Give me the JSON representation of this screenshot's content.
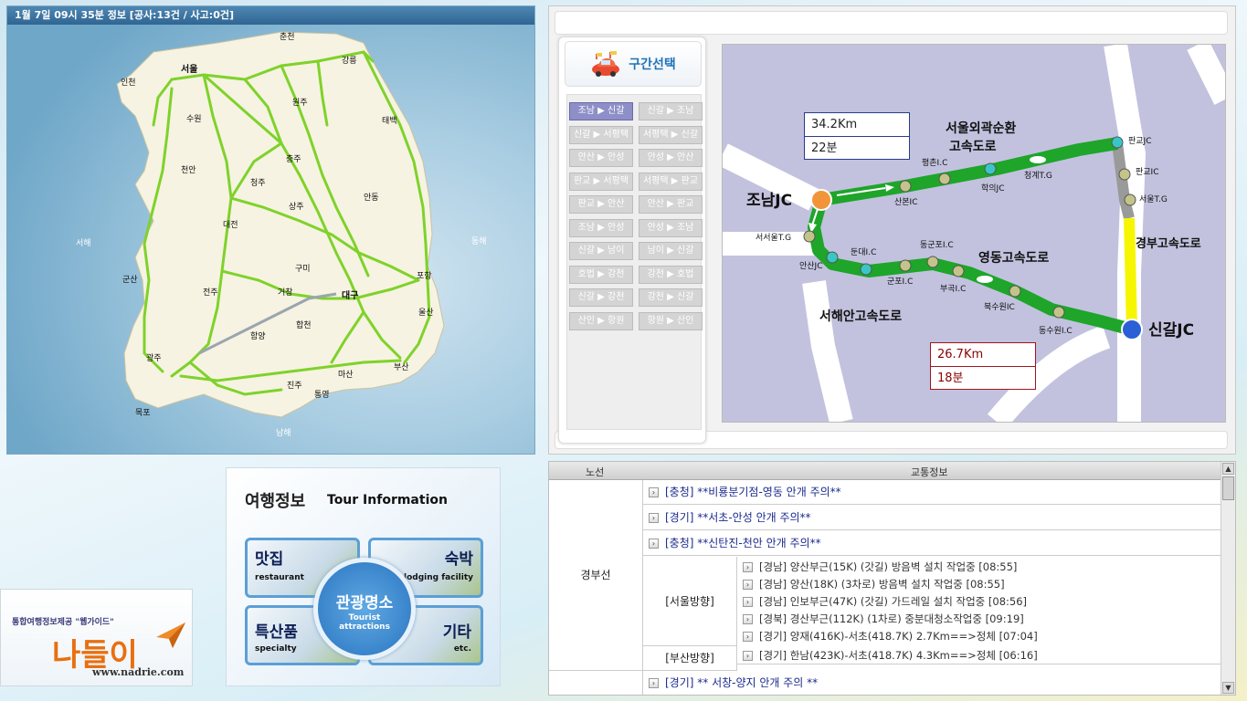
{
  "map": {
    "header": "1월 7일 09시 35분 정보 [공사:13건 / 사고:0건]",
    "cities": [
      "춘천",
      "강릉",
      "인천",
      "서울",
      "수원",
      "원주",
      "태백",
      "충주",
      "천안",
      "청주",
      "안동",
      "상주",
      "대전",
      "서해",
      "동해",
      "군산",
      "구미",
      "포항",
      "전주",
      "거창",
      "대구",
      "울산",
      "합천",
      "함양",
      "광주",
      "진주",
      "마산",
      "부산",
      "통영",
      "목포",
      "남해"
    ]
  },
  "route": {
    "section_title": "구간선택",
    "section_buttons": [
      [
        "조남 ▶ 신갈",
        "신갈 ▶ 조남"
      ],
      [
        "신갈 ▶ 서평택",
        "서평택 ▶ 신갈"
      ],
      [
        "안산 ▶ 안성",
        "안성 ▶ 안산"
      ],
      [
        "판교 ▶ 서평택",
        "서평택 ▶ 판교"
      ],
      [
        "판교 ▶ 안산",
        "안산 ▶ 판교"
      ],
      [
        "조남 ▶ 안성",
        "안성 ▶ 조남"
      ],
      [
        "신갈 ▶ 남이",
        "남이 ▶ 신갈"
      ],
      [
        "호법 ▶ 강천",
        "강천 ▶ 호법"
      ],
      [
        "신갈 ▶ 강천",
        "강천 ▶ 신갈"
      ],
      [
        "산인 ▶ 항원",
        "항원 ▶ 산인"
      ]
    ],
    "info_top": {
      "distance": "34.2Km",
      "time": "22분"
    },
    "info_bottom": {
      "distance": "26.7Km",
      "time": "18분"
    },
    "labels": {
      "jonam": "조남JC",
      "singal": "신갈JC",
      "seoul_ring": "서울외곽순환",
      "seoul_ring2": "고속도로",
      "yeongdong": "영동고속도로",
      "gyeongbu": "경부고속도로",
      "seohaean": "서해안고속도로",
      "pangyo_jc": "판교JC",
      "pangyo_ic": "판교IC",
      "seoul_tg": "서울T.G",
      "pyeongchon": "평촌I.C",
      "sanbon": "산본IC",
      "hakui": "학의JC",
      "cheonggye": "청계T.G",
      "seoseoul": "서서울T.G",
      "ansan": "안산JC",
      "dundae": "둔대I.C",
      "gunpo": "군포I.C",
      "donggunpo": "동군포I.C",
      "bugok": "부곡I.C",
      "buksuwon": "북수원IC",
      "dongsuwon": "동수원I.C"
    }
  },
  "traffic": {
    "col_route": "노선",
    "col_info": "교통정보",
    "route_name": "경부선",
    "rows": [
      "[충청] **비룡분기점-영동 안개 주의**",
      "[경기] **서초-안성 안개 주의**",
      "[충청] **신탄진-천안 안개 주의**"
    ],
    "seoul_dir": "[서울방향]",
    "seoul_items": [
      "[경남] 양산부근(15K) (갓길) 방음벽 설치 작업중 [08:55]",
      "[경남] 양산(18K) (3차로) 방음벽 설치 작업중 [08:55]",
      "[경남] 인보부근(47K) (갓길) 가드레일 설치 작업중 [08:56]",
      "[경북] 경산부근(112K) (1차로) 중분대청소작업중 [09:19]",
      "[경기] 양재(416K)-서초(418.7K) 2.7Km==>정체 [07:04]"
    ],
    "busan_dir": "[부산방향]",
    "busan_items": [
      "[경기] 한남(423K)-서초(418.7K) 4.3Km==>정체 [06:16]"
    ],
    "last_row": "[경기] ** 서창-양지 안개 주의 **"
  },
  "tour": {
    "title_ko": "여행정보",
    "title_en": "Tour Information",
    "cards": [
      {
        "ko": "맛집",
        "en": "restaurant"
      },
      {
        "ko": "숙박",
        "en": "lodging facility"
      },
      {
        "ko": "특산품",
        "en": "specialty"
      },
      {
        "ko": "기타",
        "en": "etc."
      }
    ],
    "center_ko": "관광명소",
    "center_en1": "Tourist",
    "center_en2": "attractions"
  },
  "logo": {
    "sub": "통합여행정보제공 \"웹가이드\"",
    "main": "나들이",
    "url": "www.nadrie.com"
  }
}
